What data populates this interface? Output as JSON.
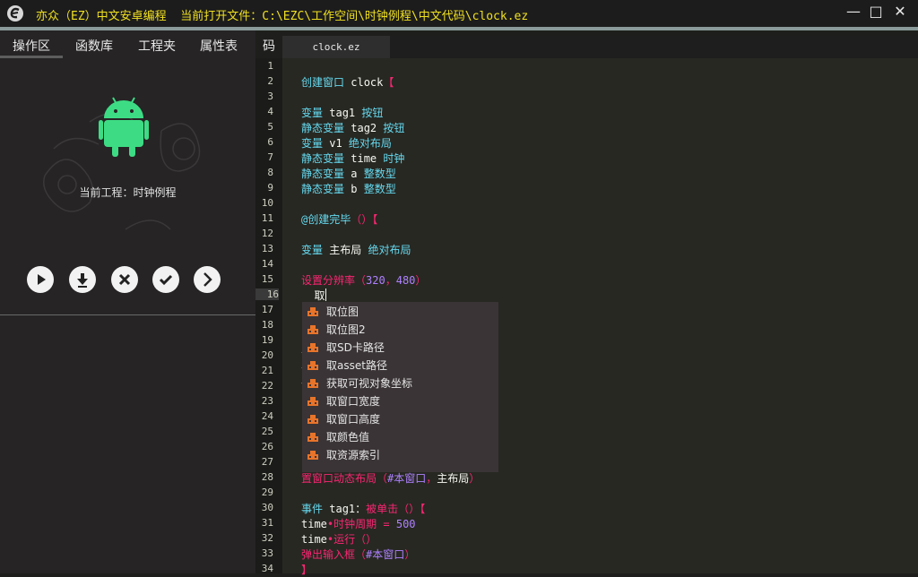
{
  "window": {
    "title": "亦众（EZ）中文安卓编程  当前打开文件：C:\\EZC\\工作空间\\时钟例程\\中文代码\\clock.ez",
    "minimize": "—",
    "maximize": "□",
    "close": "✕"
  },
  "sidebar": {
    "tabs": [
      "操作区",
      "函数库",
      "工程夹",
      "属性表"
    ],
    "active_tab": "操作区",
    "project_label": "当前工程：时钟例程",
    "buttons": [
      "run",
      "download",
      "close",
      "confirm",
      "next"
    ]
  },
  "editor": {
    "panel_label": "码",
    "file_tab": "clock.ez",
    "current_line": 16,
    "line_numbers": [
      "1",
      "2",
      "3",
      "4",
      "5",
      "6",
      "7",
      "8",
      "9",
      "10",
      "11",
      "12",
      "13",
      "14",
      "15",
      "16",
      "17",
      "18",
      "19",
      "20",
      "21",
      "22",
      "23",
      "24",
      "25",
      "26",
      "27",
      "28",
      "29",
      "30",
      "31",
      "32",
      "33",
      "34"
    ],
    "lines": {
      "l2": [
        "创建窗口",
        " clock",
        "【"
      ],
      "l4": [
        "变量",
        " tag1 ",
        "按钮"
      ],
      "l5": [
        "静态变量",
        " tag2 ",
        "按钮"
      ],
      "l6": [
        "变量",
        " v1 ",
        "绝对布局"
      ],
      "l7": [
        "静态变量",
        " time ",
        "时钟"
      ],
      "l8": [
        "静态变量",
        " a ",
        "整数型"
      ],
      "l9": [
        "静态变量",
        " b ",
        "整数型"
      ],
      "l11": [
        "@创建完毕",
        "（）",
        "【"
      ],
      "l13": [
        "变量",
        " 主布局 ",
        "绝对布局"
      ],
      "l15": [
        "设置分辨率",
        "（",
        "320",
        "，",
        "480",
        "）"
      ],
      "l16": [
        "  取"
      ],
      "l28": [
        "置窗口动态布局",
        "（",
        "#本窗口",
        "，",
        "主布局",
        "）"
      ],
      "l30": [
        "事件",
        " tag1",
        "：",
        "被单击",
        "（）",
        "【"
      ],
      "l31": [
        "time",
        "•",
        "时钟周期",
        " = ",
        "500"
      ],
      "l32": [
        "time",
        "•",
        "运行",
        "（）"
      ],
      "l33": [
        "弹出输入框",
        "（",
        "#本窗口",
        "）"
      ],
      "l34": [
        "】"
      ]
    },
    "autocomplete": [
      "取位图",
      "取位图2",
      "取SD卡路径",
      "取asset路径",
      "获取可视对象坐标",
      "取窗口宽度",
      "取窗口高度",
      "取颜色值",
      "取资源索引"
    ]
  },
  "colors": {
    "keyword": "#66d9ef",
    "text": "#f8f8f2",
    "bracket": "#f92672",
    "number": "#ae81ff",
    "title_text": "#f0e020",
    "android_green": "#3ddc84"
  }
}
